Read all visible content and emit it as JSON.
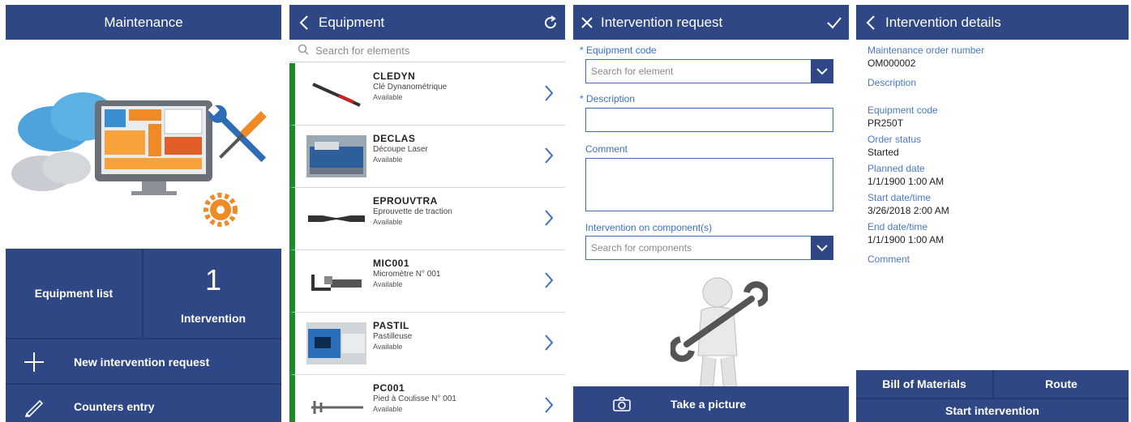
{
  "colors": {
    "primary": "#2f4785",
    "accent_green": "#1a8a2a",
    "label_blue": "#3a6fc4"
  },
  "maintenance": {
    "title": "Maintenance",
    "tiles": {
      "equipment_list": "Equipment list",
      "intervention_count": "1",
      "intervention_label": "Intervention",
      "new_request": "New intervention request",
      "counters_entry": "Counters entry"
    }
  },
  "equipment": {
    "title": "Equipment",
    "search_placeholder": "Search for elements",
    "items": [
      {
        "code": "CLEDYN",
        "name": "Clé Dynanométrique",
        "status": "Available"
      },
      {
        "code": "DECLAS",
        "name": "Découpe Laser",
        "status": "Available"
      },
      {
        "code": "EPROUVTRA",
        "name": "Eprouvette de traction",
        "status": "Available"
      },
      {
        "code": "MIC001",
        "name": "Micromètre N° 001",
        "status": "Available"
      },
      {
        "code": "PASTIL",
        "name": "Pastilleuse",
        "status": "Available"
      },
      {
        "code": "PC001",
        "name": "Pied à Coulisse N° 001",
        "status": "Available"
      }
    ]
  },
  "request": {
    "title": "Intervention request",
    "equipment_code_label": "* Equipment code",
    "equipment_code_placeholder": "Search for element",
    "description_label": "* Description",
    "comment_label": "Comment",
    "component_label": "Intervention on component(s)",
    "component_placeholder": "Search for components",
    "take_picture": "Take a picture"
  },
  "details": {
    "title": "Intervention details",
    "fields": [
      {
        "label": "Maintenance order number",
        "value": "OM000002"
      },
      {
        "label": "Description",
        "value": ""
      },
      {
        "label": "Equipment code",
        "value": "PR250T"
      },
      {
        "label": "Order status",
        "value": "Started"
      },
      {
        "label": "Planned date",
        "value": "1/1/1900 1:00 AM"
      },
      {
        "label": "Start date/time",
        "value": "3/26/2018 2:00 AM"
      },
      {
        "label": "End date/time",
        "value": "1/1/1900 1:00 AM"
      },
      {
        "label": "Comment",
        "value": ""
      }
    ],
    "bill_of_materials": "Bill of Materials",
    "route": "Route",
    "start_intervention": "Start intervention"
  }
}
